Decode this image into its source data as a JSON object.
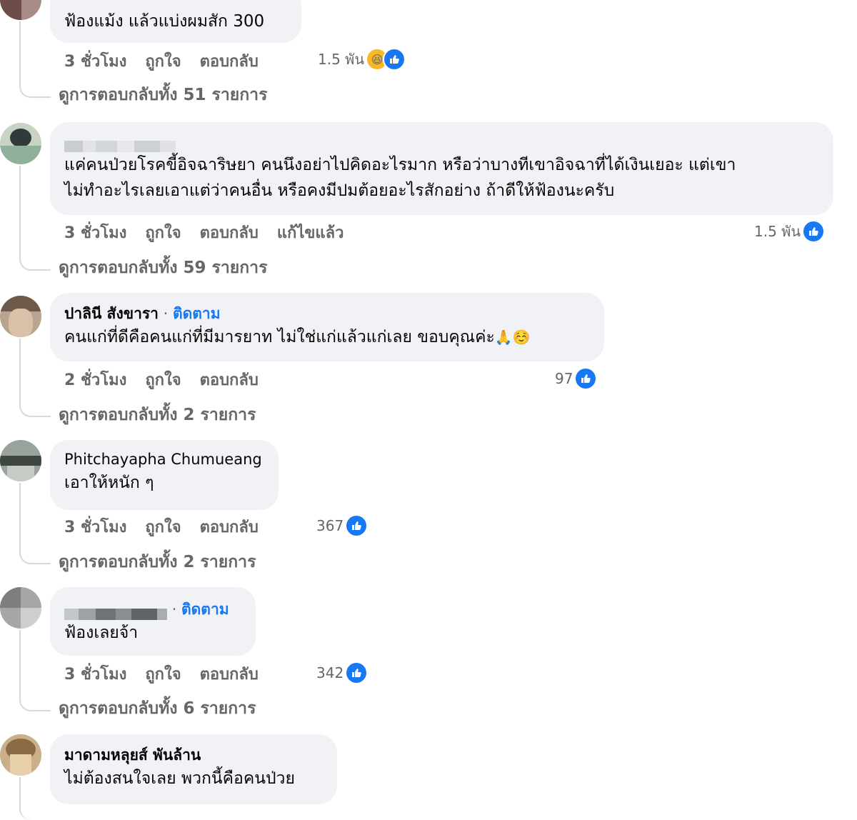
{
  "colors": {
    "accent": "#1877f2",
    "bubble": "#f0f2f5",
    "muted": "#65676b",
    "haha": "#f7b928"
  },
  "icons": {
    "like": "like-icon",
    "haha": "haha-icon"
  },
  "comments": [
    {
      "text": "ฟ้องแม้ง แล้วแบ่งผมสัก 300",
      "actions": [
        "3 ชั่วโมง",
        "ถูกใจ",
        "ตอบกลับ"
      ],
      "reaction_count": "1.5 พัน",
      "reactions": [
        "haha",
        "like"
      ],
      "view_replies": "ดูการตอบกลับทั้ง 51 รายการ"
    },
    {
      "text_lines": [
        "แค่คนป่วยโรคขี้อิจฉาริษยา คนนึงอย่าไปคิดอะไรมาก หรือว่าบางทีเขาอิจฉาที่ได้เงินเยอะ แต่เขา",
        "ไม่ทำอะไรเลยเอาแต่ว่าคนอื่น หรือคงมีปมต้อยอะไรสักอย่าง ถ้าดีให้ฟ้องนะครับ"
      ],
      "actions": [
        "3 ชั่วโมง",
        "ถูกใจ",
        "ตอบกลับ",
        "แก้ไขแล้ว"
      ],
      "reaction_count": "1.5 พัน",
      "reactions": [
        "like"
      ],
      "view_replies": "ดูการตอบกลับทั้ง 59 รายการ"
    },
    {
      "author": "ปาลินี สังขารา",
      "separator": " · ",
      "follow": "ติดตาม",
      "text": "คนแก่ที่ดีคือคนแก่ที่มีมารยาท ไม่ใช่แก่แล้วแก่เลย ขอบคุณค่ะ",
      "emojis": "🙏☺️",
      "actions": [
        "2 ชั่วโมง",
        "ถูกใจ",
        "ตอบกลับ"
      ],
      "reaction_count": "97",
      "reactions": [
        "like"
      ],
      "view_replies": "ดูการตอบกลับทั้ง 2 รายการ"
    },
    {
      "author": "Phitchayapha Chumueang",
      "text": "เอาให้หนัก ๆ",
      "actions": [
        "3 ชั่วโมง",
        "ถูกใจ",
        "ตอบกลับ"
      ],
      "reaction_count": "367",
      "reactions": [
        "like"
      ],
      "view_replies": "ดูการตอบกลับทั้ง 2 รายการ"
    },
    {
      "separator": " · ",
      "follow": "ติดตาม",
      "text": "ฟ้องเลยจ้า",
      "actions": [
        "3 ชั่วโมง",
        "ถูกใจ",
        "ตอบกลับ"
      ],
      "reaction_count": "342",
      "reactions": [
        "like"
      ],
      "view_replies": "ดูการตอบกลับทั้ง 6 รายการ"
    },
    {
      "author": "มาดามหลุยส์ พันล้าน",
      "text": "ไม่ต้องสนใจเลย พวกนี้คือคนป่วย"
    }
  ]
}
